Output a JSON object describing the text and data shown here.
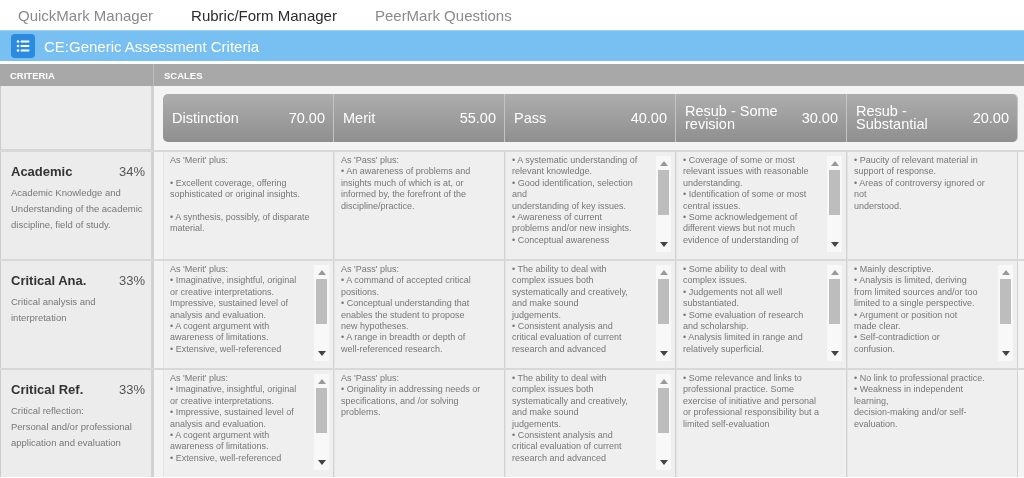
{
  "tabs": [
    {
      "label": "QuickMark Manager",
      "selected": false
    },
    {
      "label": "Rubric/Form Manager",
      "selected": true
    },
    {
      "label": "PeerMark Questions",
      "selected": false
    }
  ],
  "title": "CE:Generic Assessment Criteria",
  "column_headers": {
    "criteria": "CRITERIA",
    "scales": "SCALES"
  },
  "scales": [
    {
      "name": "Distinction",
      "score": "70.00"
    },
    {
      "name": "Merit",
      "score": "55.00"
    },
    {
      "name": "Pass",
      "score": "40.00"
    },
    {
      "name": "Resub - Some revision",
      "score": "30.00"
    },
    {
      "name": "Resub - Substantial",
      "score": "20.00"
    }
  ],
  "criteria": [
    {
      "name": "Academic",
      "weight": "34%",
      "description": "Academic Knowledge and Understanding of the academic discipline, field of study.",
      "cells": [
        {
          "kind": "plain",
          "text": "As 'Merit' plus:\n\n• Excellent coverage, offering\nsophisticated or original insights.\n\n• A synthesis, possibly, of disparate\nmaterial."
        },
        {
          "kind": "plain",
          "text": "As 'Pass' plus:\n• An awareness of problems and\ninsights much of which is at, or\ninformed by, the forefront of the\ndiscipline/practice."
        },
        {
          "kind": "scrolling",
          "text": "• A systematic understanding of\nrelevant knowledge.\n• Good identification, selection\nand\nunderstanding of key issues.\n• Awareness of current\nproblems and/or new insights.\n• Conceptual awareness"
        },
        {
          "kind": "scrolling",
          "text": "• Coverage of some or most\nrelevant issues with reasonable\nunderstanding.\n• Identification of some or most\ncentral issues.\n• Some acknowledgement of\ndifferent views but not much\nevidence of understanding of"
        },
        {
          "kind": "plain",
          "text": "• Paucity of relevant material in\nsupport of response.\n• Areas of controversy ignored or\nnot\nunderstood."
        }
      ]
    },
    {
      "name": "Critical Ana.",
      "weight": "33%",
      "description": "Critical analysis and interpretation",
      "cells": [
        {
          "kind": "scrolling",
          "text": "As 'Merit' plus:\n• Imaginative, insightful, original\nor creative interpretations.\nImpressive, sustained level of\nanalysis and evaluation.\n• A cogent argument with\nawareness of limitations.\n• Extensive, well-referenced"
        },
        {
          "kind": "plain",
          "text": "As 'Pass' plus:\n• A command of accepted critical\npositions.\n• Conceptual understanding that\nenables the student to propose\nnew hypotheses.\n• A range in breadth or depth of\nwell-referenced research."
        },
        {
          "kind": "scrolling",
          "text": "• The ability to deal with\ncomplex issues both\nsystematically and creatively,\nand make sound\njudgements.\n• Consistent analysis and\ncritical evaluation of current\nresearch and advanced"
        },
        {
          "kind": "scrolling",
          "text": "• Some ability to deal with\ncomplex issues.\n• Judgements not all well\nsubstantiated.\n• Some evaluation of research\nand scholarship.\n• Analysis limited in range and\nrelatively superficial."
        },
        {
          "kind": "scrolling",
          "text": "• Mainly descriptive.\n• Analysis is limited, deriving\nfrom limited sources and/or too\nlimited to a single perspective.\n• Argument or position not\nmade clear.\n• Self-contradiction or\nconfusion."
        }
      ]
    },
    {
      "name": "Critical Ref.",
      "weight": "33%",
      "description": "Critical reflection:\nPersonal and/or professional application and evaluation",
      "cells": [
        {
          "kind": "scrolling",
          "text": "As 'Merit' plus:\n• Imaginative, insightful, original\nor creative interpretations.\n• Impressive, sustained level of\nanalysis and evaluation.\n• A cogent argument with\nawareness of limitations.\n• Extensive, well-referenced"
        },
        {
          "kind": "plain",
          "text": "As 'Pass' plus:\n• Originality in addressing needs or\nspecifications, and /or solving\nproblems."
        },
        {
          "kind": "scrolling",
          "text": "• The ability to deal with\ncomplex issues both\nsystematically and creatively,\nand make sound\njudgements.\n• Consistent analysis and\ncritical evaluation of current\nresearch and advanced"
        },
        {
          "kind": "plain",
          "text": "• Some relevance and links to\nprofessional practice. Some\nexercise of initiative and personal\nor professional responsibility but a\nlimited self-evaluation"
        },
        {
          "kind": "plain",
          "text": "• No link to professional practice.\n• Weakness in independent\nlearning,\ndecision-making and/or self-\nevaluation."
        }
      ]
    }
  ]
}
